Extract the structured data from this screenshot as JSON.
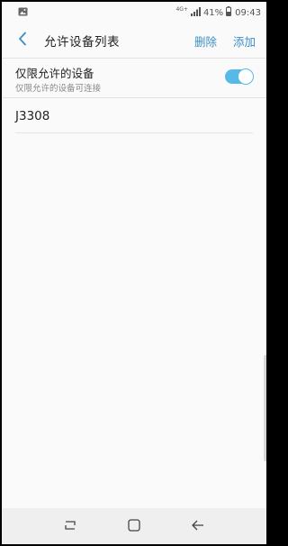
{
  "status_bar": {
    "network": "4G+",
    "battery_percent": "41%",
    "time": "09:43",
    "icons": [
      "photo-notification-icon",
      "network-icon",
      "signal-icon",
      "battery-icon"
    ]
  },
  "app_bar": {
    "title": "允许设备列表",
    "delete_label": "删除",
    "add_label": "添加",
    "accent_color": "#3b8fc4"
  },
  "toggle": {
    "title": "仅限允许的设备",
    "subtitle": "仅限允许的设备可连接",
    "enabled": true,
    "color": "#57b9e7"
  },
  "devices": [
    {
      "name": "J3308"
    }
  ],
  "nav_bar": {
    "icons": [
      "recent-apps-icon",
      "home-icon",
      "back-icon"
    ]
  }
}
